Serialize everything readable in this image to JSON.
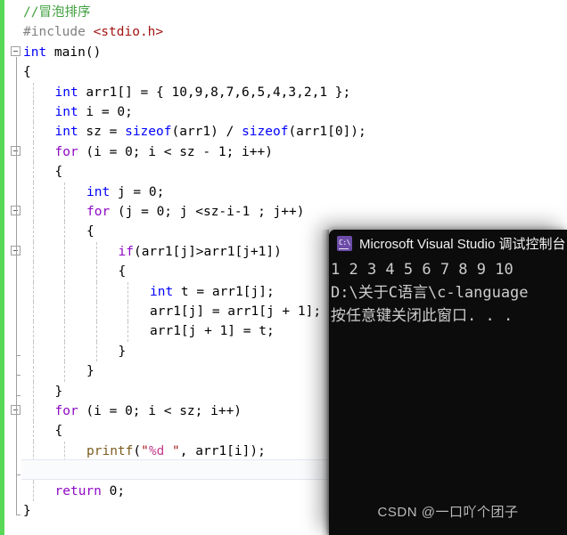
{
  "editor": {
    "name": "visual-studio-code-editor",
    "colors": {
      "background": "#ffffff",
      "keyword": "#0000ff",
      "control_keyword": "#8f08c4",
      "comment": "#3f9f3f",
      "preprocessor": "#808080",
      "string": "#a31515",
      "format_specifier": "#c43c8f",
      "function": "#7a5c1e",
      "change_bar": "#57d957",
      "current_line_fill": "#fafbfd"
    },
    "lines": [
      {
        "indent": 0,
        "fold": "none",
        "tokens": [
          {
            "t": "//冒泡排序",
            "c": "cmt"
          }
        ]
      },
      {
        "indent": 0,
        "fold": "none",
        "tokens": [
          {
            "t": "#include ",
            "c": "pre"
          },
          {
            "t": "<stdio.h>",
            "c": "str"
          }
        ]
      },
      {
        "indent": 0,
        "fold": "open",
        "tokens": [
          {
            "t": "int",
            "c": "kw"
          },
          {
            "t": " main()",
            "c": "id"
          }
        ]
      },
      {
        "indent": 0,
        "fold": "line",
        "tokens": [
          {
            "t": "{",
            "c": "id"
          }
        ]
      },
      {
        "indent": 1,
        "fold": "line",
        "tokens": [
          {
            "t": "int",
            "c": "kw"
          },
          {
            "t": " arr1[] = { 10,9,8,7,6,5,4,3,2,1 };",
            "c": "id"
          }
        ]
      },
      {
        "indent": 1,
        "fold": "line",
        "tokens": [
          {
            "t": "int",
            "c": "kw"
          },
          {
            "t": " i = 0;",
            "c": "id"
          }
        ]
      },
      {
        "indent": 1,
        "fold": "line",
        "tokens": [
          {
            "t": "int",
            "c": "kw"
          },
          {
            "t": " sz = ",
            "c": "id"
          },
          {
            "t": "sizeof",
            "c": "kw"
          },
          {
            "t": "(arr1) / ",
            "c": "id"
          },
          {
            "t": "sizeof",
            "c": "kw"
          },
          {
            "t": "(arr1[0]);",
            "c": "id"
          }
        ]
      },
      {
        "indent": 1,
        "fold": "open",
        "tokens": [
          {
            "t": "for",
            "c": "ctl"
          },
          {
            "t": " (i = 0; i < sz - 1; i++)",
            "c": "id"
          }
        ]
      },
      {
        "indent": 1,
        "fold": "line",
        "tokens": [
          {
            "t": "{",
            "c": "id"
          }
        ]
      },
      {
        "indent": 2,
        "fold": "line",
        "tokens": [
          {
            "t": "int",
            "c": "kw"
          },
          {
            "t": " j = 0;",
            "c": "id"
          }
        ]
      },
      {
        "indent": 2,
        "fold": "open",
        "tokens": [
          {
            "t": "for",
            "c": "ctl"
          },
          {
            "t": " (j = 0; j <sz-i-1 ; j++)",
            "c": "id"
          }
        ]
      },
      {
        "indent": 2,
        "fold": "line",
        "tokens": [
          {
            "t": "{",
            "c": "id"
          }
        ]
      },
      {
        "indent": 3,
        "fold": "open",
        "tokens": [
          {
            "t": "if",
            "c": "ctl"
          },
          {
            "t": "(arr1[j]>arr1[j+1])",
            "c": "id"
          }
        ]
      },
      {
        "indent": 3,
        "fold": "line",
        "tokens": [
          {
            "t": "{",
            "c": "id"
          }
        ]
      },
      {
        "indent": 4,
        "fold": "line",
        "tokens": [
          {
            "t": "int",
            "c": "kw"
          },
          {
            "t": " t = arr1[j];",
            "c": "id"
          }
        ]
      },
      {
        "indent": 4,
        "fold": "line",
        "tokens": [
          {
            "t": "arr1[j] = arr1[j + 1];",
            "c": "id"
          }
        ]
      },
      {
        "indent": 4,
        "fold": "line",
        "tokens": [
          {
            "t": "arr1[j + 1] = t;",
            "c": "id"
          }
        ]
      },
      {
        "indent": 3,
        "fold": "end",
        "tokens": [
          {
            "t": "}",
            "c": "id"
          }
        ]
      },
      {
        "indent": 2,
        "fold": "end",
        "tokens": [
          {
            "t": "}",
            "c": "id"
          }
        ]
      },
      {
        "indent": 1,
        "fold": "end",
        "tokens": [
          {
            "t": "}",
            "c": "id"
          }
        ]
      },
      {
        "indent": 1,
        "fold": "open",
        "tokens": [
          {
            "t": "for",
            "c": "ctl"
          },
          {
            "t": " (i = 0; i < sz; i++)",
            "c": "id"
          }
        ]
      },
      {
        "indent": 1,
        "fold": "line",
        "tokens": [
          {
            "t": "{",
            "c": "id"
          }
        ]
      },
      {
        "indent": 2,
        "fold": "line",
        "tokens": [
          {
            "t": "printf",
            "c": "fn"
          },
          {
            "t": "(",
            "c": "id"
          },
          {
            "t": "\"",
            "c": "str"
          },
          {
            "t": "%d",
            "c": "fmt"
          },
          {
            "t": " \"",
            "c": "str"
          },
          {
            "t": ", arr1[i]);",
            "c": "id"
          }
        ]
      },
      {
        "indent": 1,
        "fold": "end",
        "tokens": [
          {
            "t": "}",
            "c": "id"
          }
        ],
        "current": true
      },
      {
        "indent": 1,
        "fold": "line",
        "tokens": [
          {
            "t": "return",
            "c": "ctl"
          },
          {
            "t": " 0;",
            "c": "id"
          }
        ]
      },
      {
        "indent": 0,
        "fold": "end",
        "tokens": [
          {
            "t": "}",
            "c": "id"
          }
        ]
      }
    ]
  },
  "console": {
    "name": "debug-console-window",
    "title": "Microsoft Visual Studio 调试控制台",
    "icon": "console-app-icon",
    "icon_glyph": "C:\\",
    "background": "#0c0c0c",
    "output": [
      "1 2 3 4 5 6 7 8 9 10",
      "D:\\关于C语言\\c-language",
      "按任意键关闭此窗口. . ."
    ]
  },
  "watermark": {
    "text": "CSDN @一口吖个团子"
  }
}
